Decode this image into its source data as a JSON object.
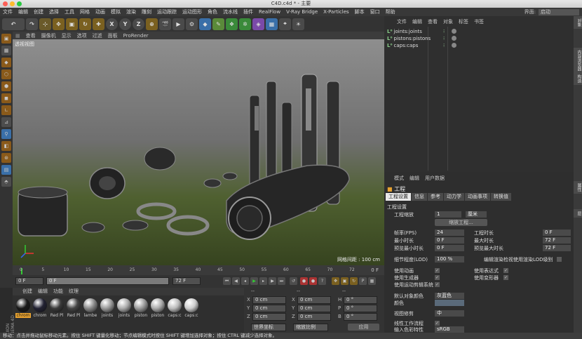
{
  "window": {
    "title": "C4D.c4d * - 主要"
  },
  "menu": [
    "文件",
    "编辑",
    "创建",
    "选择",
    "工具",
    "网格",
    "动画",
    "模拟",
    "渲染",
    "雕刻",
    "运动跟踪",
    "运动图形",
    "角色",
    "流水线",
    "插件",
    "RealFlow",
    "V-Ray Bridge",
    "X-Particles",
    "脚本",
    "窗口",
    "帮助"
  ],
  "layout": {
    "label": "界面:",
    "value": "启动"
  },
  "toolbar": {
    "icons": [
      "undo-icon",
      "redo-icon",
      "select-icon",
      "move-icon",
      "scale-icon",
      "rotate-icon",
      "add-icon",
      "x-axis-icon",
      "y-axis-icon",
      "z-axis-icon",
      "coords-icon",
      "clapper-icon",
      "render-icon",
      "render-settings-icon",
      "cube-icon",
      "pen-icon",
      "subdivide-icon",
      "cloner-icon",
      "deformer-icon",
      "floor-icon",
      "camera-icon",
      "light-icon"
    ],
    "axes": [
      "X",
      "Y",
      "Z"
    ]
  },
  "viewport": {
    "menu": [
      "查看",
      "摄像机",
      "显示",
      "选项",
      "过滤",
      "面板",
      "ProRender"
    ],
    "label": "透视视图",
    "grid": "网格间距 : 100 cm"
  },
  "timeline": {
    "ticks": [
      "0",
      "5",
      "10",
      "15",
      "20",
      "25",
      "30",
      "35",
      "40",
      "45",
      "50",
      "55",
      "60",
      "65",
      "70",
      "72"
    ],
    "frame": "0 F"
  },
  "transport": {
    "start": "0 F",
    "current": "0 F",
    "end": "72 F",
    "max": "72 F"
  },
  "materials": {
    "menu": [
      "创建",
      "编辑",
      "功能",
      "纹理"
    ],
    "items": [
      {
        "label": "chrom",
        "color": "#1a1a1a"
      },
      {
        "label": "chrom",
        "color": "#222233"
      },
      {
        "label": "Red Pl",
        "color": "#3a3a3a"
      },
      {
        "label": "Red Pl",
        "color": "#444"
      },
      {
        "label": "lambe",
        "color": "#888"
      },
      {
        "label": "joints",
        "color": "#999"
      },
      {
        "label": "joints",
        "color": "#aaa"
      },
      {
        "label": "piston",
        "color": "#999"
      },
      {
        "label": "piston",
        "color": "#aaa"
      },
      {
        "label": "caps:c",
        "color": "#bbb"
      },
      {
        "label": "caps:c",
        "color": "#ccc"
      }
    ]
  },
  "coords": {
    "headers": [
      "--",
      "--",
      "--"
    ],
    "rows": [
      {
        "a": "X",
        "av": "0 cm",
        "b": "X",
        "bv": "0 cm",
        "c": "H",
        "cv": "0 °"
      },
      {
        "a": "Y",
        "av": "0 cm",
        "b": "Y",
        "bv": "0 cm",
        "c": "P",
        "cv": "0 °"
      },
      {
        "a": "Z",
        "av": "0 cm",
        "b": "Z",
        "bv": "0 cm",
        "c": "B",
        "cv": "0 °"
      }
    ],
    "mode1": "世界坐标",
    "mode2": "缩放比例",
    "apply": "应用"
  },
  "objects": {
    "menu": [
      "文件",
      "编辑",
      "查看",
      "对象",
      "标签",
      "书签"
    ],
    "items": [
      "joints:joints",
      "pistons:pistons",
      "caps:caps"
    ]
  },
  "sidetabs": [
    "对象",
    "内容浏览器",
    "构造",
    "属性",
    "层"
  ],
  "attributes": {
    "menu": [
      "模式",
      "编辑",
      "用户数据"
    ],
    "title": "工程",
    "tabs": [
      "工程设置",
      "信息",
      "参考",
      "动力学",
      "动画事项",
      "转换值"
    ],
    "section": "工程设置",
    "scale_label": "工程缩放",
    "scale_value": "1",
    "scale_unit": "厘米",
    "scale_btn": "缩放工程...",
    "left_fields": [
      {
        "label": "帧率(FPS)",
        "value": "24"
      },
      {
        "label": "最小时长",
        "value": "0 F"
      },
      {
        "label": "预览最小时长",
        "value": "0 F"
      },
      {
        "label": "细节程度(LOD)",
        "value": "100 %"
      }
    ],
    "right_fields": [
      {
        "label": "工程时长",
        "value": "0 F"
      },
      {
        "label": "最大时长",
        "value": "72 F"
      },
      {
        "label": "预览最大时长",
        "value": "72 F"
      }
    ],
    "lod_check": "编辑渲染检视使用渲染LOD级别",
    "checks_left": [
      "使用动画",
      "使用生成器",
      "使用运动剪辑系统"
    ],
    "checks_right": [
      "使用表达式",
      "使用变形器"
    ],
    "default_color_label": "默认对象颜色",
    "default_color_value": "灰蓝色",
    "color_label": "颜色",
    "view_clip_label": "视图修剪",
    "view_clip_value": "中",
    "linear_label": "线性工作流程",
    "input_color_label": "输入色彩特性",
    "input_color_value": "sRGB"
  },
  "status": "移动：点击并拖动鼠标移动元素。按住 SHIFT 键量化移动；节点编辑模式时按住 SHIFT 键增加选择对象；按住 CTRL 键减少选择对象。"
}
